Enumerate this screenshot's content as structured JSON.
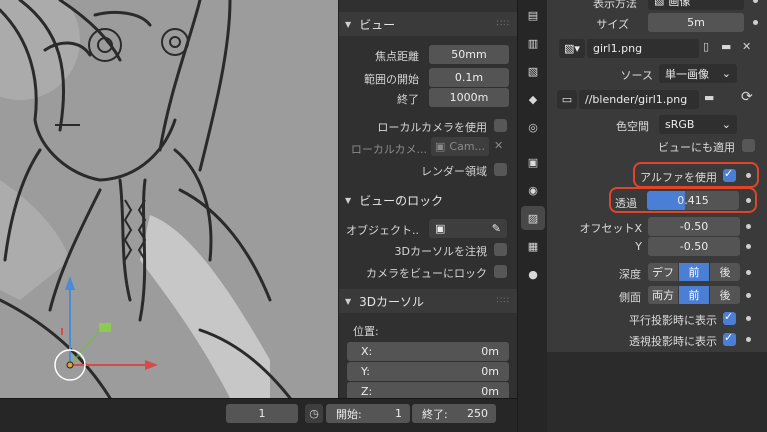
{
  "view_panel": {
    "header": "ビュー",
    "focal_label": "焦点距離",
    "focal_value": "50mm",
    "clip_start_label": "範囲の開始",
    "clip_start_value": "0.1m",
    "clip_end_label": "終了",
    "clip_end_value": "1000m",
    "local_camera_label": "ローカルカメラを使用",
    "local_camera_field_label": "ローカルカメ...",
    "local_camera_field_value": "Cam...",
    "render_region_label": "レンダー領域"
  },
  "view_lock": {
    "header": "ビューのロック",
    "object_label": "オブジェクト..",
    "cursor_label": "3Dカーソルを注視",
    "camera_lock_label": "カメラをビューにロック"
  },
  "cursor_panel": {
    "header": "3Dカーソル",
    "location_label": "位置:",
    "x_label": "X:",
    "x_value": "0m",
    "y_label": "Y:",
    "y_value": "0m",
    "z_label": "Z:",
    "z_value": "0m"
  },
  "properties": {
    "display_label": "表示方法",
    "display_value": "画像",
    "size_label": "サイズ",
    "size_value": "5m",
    "image_name": "girl1.png",
    "source_label": "ソース",
    "source_value": "単一画像",
    "filepath": "//blender/girl1.png",
    "colorspace_label": "色空間",
    "colorspace_value": "sRGB",
    "apply_view_label": "ビューにも適用",
    "use_alpha_label": "アルファを使用",
    "opacity_label": "透過",
    "opacity_value": "0.415",
    "opacity_fraction": 0.415,
    "offset_x_label": "オフセットX",
    "offset_x_value": "-0.50",
    "offset_y_label": "Y",
    "offset_y_value": "-0.50",
    "depth_label": "深度",
    "depth_options": [
      "デフ",
      "前",
      "後"
    ],
    "side_label": "側面",
    "side_options": [
      "両方",
      "前",
      "後"
    ],
    "ortho_label": "平行投影時に表示",
    "persp_label": "透視投影時に表示"
  },
  "timeline": {
    "current_frame": "1",
    "start_label": "開始:",
    "start_value": "1",
    "end_label": "終了:",
    "end_value": "250"
  },
  "colors": {
    "accent_blue": "#4b7fd6",
    "highlight_red": "#e0452c"
  }
}
